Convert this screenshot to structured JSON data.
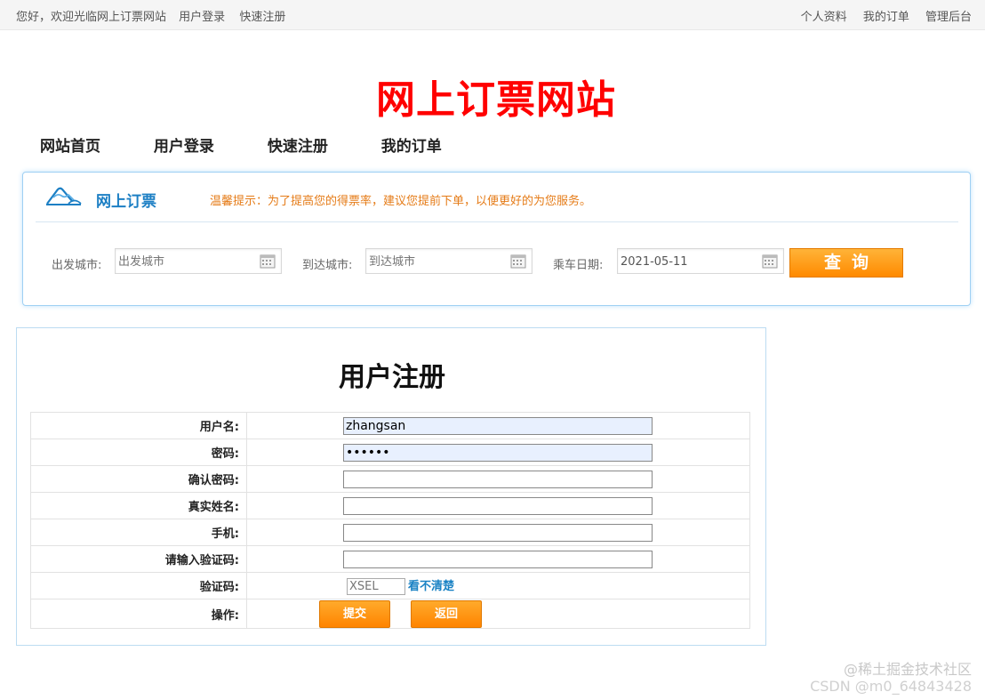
{
  "topbar": {
    "welcome": "您好，欢迎光临网上订票网站",
    "login": "用户登录",
    "register": "快速注册",
    "profile": "个人资料",
    "orders": "我的订单",
    "admin": "管理后台"
  },
  "site_title": "网上订票网站",
  "nav": {
    "home": "网站首页",
    "login": "用户登录",
    "register": "快速注册",
    "orders": "我的订单"
  },
  "search": {
    "title": "网上订票",
    "tip": "温馨提示：为了提高您的得票率，建议您提前下单，以便更好的为您服务。",
    "from_label": "出发城市:",
    "from_placeholder": "出发城市",
    "to_label": "到达城市:",
    "to_placeholder": "到达城市",
    "date_label": "乘车日期:",
    "date_value": "2021-05-11",
    "query_button": "查询",
    "calendar_icon": "calendar-icon",
    "logo_icon": "mountain-logo-icon"
  },
  "register": {
    "title": "用户注册",
    "fields": {
      "username_label": "用户名:",
      "username_value": "zhangsan",
      "password_label": "密码:",
      "password_value": "••••••",
      "confirm_label": "确认密码:",
      "realname_label": "真实姓名:",
      "phone_label": "手机:",
      "captcha_input_label": "请输入验证码:",
      "captcha_label": "验证码:",
      "captcha_placeholder": "XSEL",
      "captcha_refresh": "看不清楚",
      "op_label": "操作:"
    },
    "submit_button": "提交",
    "back_button": "返回"
  },
  "watermark": {
    "line1": "@稀土掘金技术社区",
    "line2": "CSDN @m0_64843428"
  },
  "colors": {
    "title_red": "#ff0000",
    "accent_blue": "#1c7fc4",
    "tip_orange": "#e57b17",
    "button_orange": "#ff8a00"
  }
}
